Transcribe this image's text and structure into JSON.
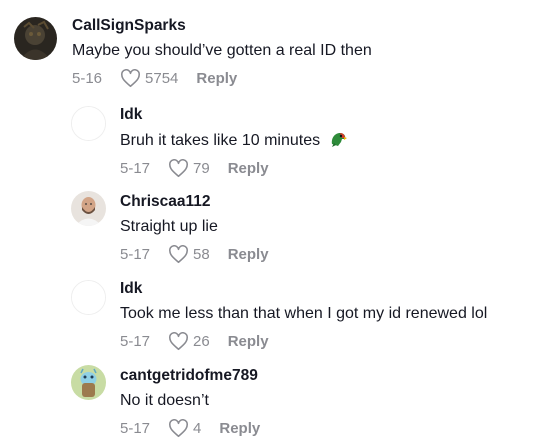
{
  "comments": [
    {
      "username": "CallSignSparks",
      "text": "Maybe you should’ve gotten a real ID then",
      "date": "5-16",
      "likes": "5754",
      "reply_label": "Reply",
      "avatar": "dark-photo-avatar"
    },
    {
      "username": "Idk",
      "text": "Bruh it takes like 10 minutes",
      "emoji": "parrot-emoji",
      "date": "5-17",
      "likes": "79",
      "reply_label": "Reply",
      "avatar": "blank-avatar"
    },
    {
      "username": "Chriscaa112",
      "text": "Straight up lie",
      "date": "5-17",
      "likes": "58",
      "reply_label": "Reply",
      "avatar": "bald-man-avatar"
    },
    {
      "username": "Idk",
      "text": "Took me less than that when I got my id renewed lol",
      "date": "5-17",
      "likes": "26",
      "reply_label": "Reply",
      "avatar": "blank-avatar"
    },
    {
      "username": "cantgetridofme789",
      "text": "No it doesn’t",
      "date": "5-17",
      "likes": "4",
      "reply_label": "Reply",
      "avatar": "green-cartoon-avatar"
    }
  ],
  "colors": {
    "text": "#161823",
    "meta": "#8a8b91"
  }
}
